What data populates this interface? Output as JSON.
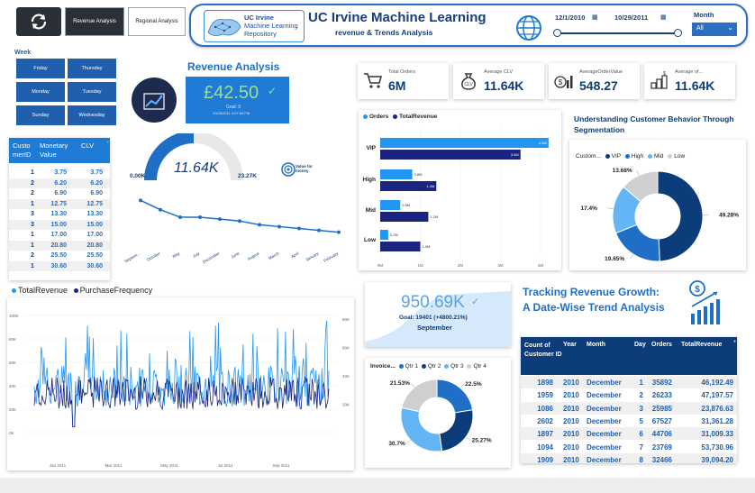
{
  "nav": {
    "revenue_tab": "Revenue Analysis",
    "regional_tab": "Regional Analysis"
  },
  "header": {
    "logo_line1": "UC Irvine",
    "logo_line2": "Machine Learning",
    "logo_line3": "Repository",
    "title": "UC Irvine Machine Learning",
    "subtitle": "revenue & Trends Analysis",
    "date_start": "12/1/2010",
    "date_end": "10/29/2011",
    "period_label": "Month",
    "period_value": "All"
  },
  "week": {
    "title": "Week",
    "days": [
      "Friday",
      "Thursday",
      "Monday",
      "Tuesday",
      "Sunday",
      "Wednesday"
    ]
  },
  "revenue_card": {
    "title": "Revenue Analysis",
    "value": "£42.50",
    "goal": "Goal: 0",
    "timestamp": "10/28/2011 4:07:00 PM"
  },
  "customer_table": {
    "headers": [
      "Custo merID",
      "Monetary Value",
      "CLV"
    ],
    "rows": [
      [
        "1",
        "3.75",
        "3.75"
      ],
      [
        "2",
        "6.20",
        "6.20"
      ],
      [
        "2",
        "6.90",
        "6.90"
      ],
      [
        "1",
        "12.75",
        "12.75"
      ],
      [
        "3",
        "13.30",
        "13.30"
      ],
      [
        "3",
        "15.00",
        "15.00"
      ],
      [
        "1",
        "17.00",
        "17.00"
      ],
      [
        "1",
        "20.80",
        "20.80"
      ],
      [
        "2",
        "25.50",
        "25.50"
      ],
      [
        "1",
        "30.60",
        "30.60"
      ]
    ]
  },
  "gauge": {
    "value": "11.64K",
    "min": "0.00K",
    "max": "23.27K",
    "fraction": 0.5
  },
  "value_for_money": "Value for money",
  "clv_trend": {
    "months": [
      "Septem...",
      "October",
      "May",
      "July",
      "December",
      "June",
      "August",
      "March",
      "April",
      "January",
      "February"
    ],
    "values": [
      12.6,
      12.1,
      11.7,
      11.7,
      11.6,
      11.5,
      11.3,
      11.2,
      11.1,
      11.0,
      10.9
    ]
  },
  "kpis": [
    {
      "label": "Total Orders",
      "value": "6M",
      "icon": "cart-icon"
    },
    {
      "label": "Average CLV",
      "value": "11.64K",
      "icon": "money-bag-icon"
    },
    {
      "label": "AverageOrderValue",
      "value": "548.27",
      "icon": "dollar-chart-icon"
    },
    {
      "label": "Average of...",
      "value": "11.64K",
      "icon": "coins-icon"
    }
  ],
  "segment_bar": {
    "legend": [
      "Orders",
      "TotalRevenue"
    ],
    "colors": [
      "#2196f3",
      "#1a237e"
    ],
    "x_ticks": [
      "0M",
      "1M",
      "2M",
      "3M",
      "4M"
    ]
  },
  "segmentation": {
    "title": "Understanding Customer Behavior Through Segmentation",
    "legend_title": "Custom...",
    "legend": [
      "VIP",
      "High",
      "Mid",
      "Low"
    ]
  },
  "timeseries": {
    "legend": [
      "TotalRevenue",
      "PurchaseFrequency"
    ],
    "left_ticks": [
      "100K",
      "80K",
      "60K",
      "40K",
      "20K",
      "0K"
    ],
    "right_ticks": [
      "80K",
      "60K",
      "40K",
      "20K"
    ],
    "x_ticks": [
      "Jan 2011",
      "Mar 2011",
      "May 2011",
      "Jul 2011",
      "Sep 2011"
    ]
  },
  "peak": {
    "value": "950.69K",
    "goal_text": "Goal: 19401 (+4800.21%)",
    "month": "September"
  },
  "quarter": {
    "legend_title": "Invoice...",
    "legend": [
      "Qtr 1",
      "Qtr 2",
      "Qtr 3",
      "Qtr 4"
    ]
  },
  "growth": {
    "title_line1": "Tracking Revenue Growth:",
    "title_line2": "A Date-Wise Trend Analysis"
  },
  "date_table": {
    "headers": [
      "Count of Customer ID",
      "Year",
      "Month",
      "Day",
      "Orders",
      "TotalRevenue"
    ],
    "rows": [
      [
        "1898",
        "2010",
        "December",
        "1",
        "35892",
        "46,192.49"
      ],
      [
        "1959",
        "2010",
        "December",
        "2",
        "26233",
        "47,197.57"
      ],
      [
        "1086",
        "2010",
        "December",
        "3",
        "25985",
        "23,876.63"
      ],
      [
        "2602",
        "2010",
        "December",
        "5",
        "67527",
        "31,361.28"
      ],
      [
        "1897",
        "2010",
        "December",
        "6",
        "44706",
        "31,009.33"
      ],
      [
        "1094",
        "2010",
        "December",
        "7",
        "23769",
        "53,730.96"
      ],
      [
        "1909",
        "2010",
        "December",
        "8",
        "32466",
        "39,094.20"
      ]
    ]
  },
  "chart_data": [
    {
      "type": "bar",
      "orientation": "horizontal",
      "categories": [
        "VIP",
        "High",
        "Mid",
        "Low"
      ],
      "series": [
        {
          "name": "Orders",
          "values": [
            4.2,
            0.8,
            0.5,
            0.2
          ],
          "labels": [
            "4.2M",
            "0.8M",
            "0.5M",
            "0.2M"
          ]
        },
        {
          "name": "TotalRevenue",
          "values": [
            3.5,
            1.4,
            1.2,
            1.0
          ],
          "labels": [
            "3.5M",
            "1.4M",
            "1.2M",
            "1.0M"
          ]
        }
      ],
      "xlim": [
        0,
        4
      ]
    },
    {
      "type": "pie",
      "title": "Understanding Customer Behavior Through Segmentation",
      "labels": [
        "VIP",
        "High",
        "Mid",
        "Low"
      ],
      "values": [
        49.28,
        19.65,
        17.4,
        13.68
      ],
      "value_labels": [
        "49.28%",
        "19.65%",
        "17.4%",
        "13.68%"
      ],
      "colors": [
        "#0d3c7a",
        "#1f6fc7",
        "#64b5f6",
        "#cfcfcf"
      ]
    },
    {
      "type": "pie",
      "labels": [
        "Qtr 1",
        "Qtr 2",
        "Qtr 3",
        "Qtr 4"
      ],
      "values": [
        22.5,
        25.27,
        30.7,
        21.53
      ],
      "value_labels": [
        "22.5%",
        "25.27%",
        "30.7%",
        "21.53%"
      ],
      "colors": [
        "#1f6fc7",
        "#0d3c7a",
        "#64b5f6",
        "#cfcfcf"
      ]
    },
    {
      "type": "line",
      "categories": [
        "Septem...",
        "October",
        "May",
        "July",
        "December",
        "June",
        "August",
        "March",
        "April",
        "January",
        "February"
      ],
      "values": [
        12.6,
        12.1,
        11.7,
        11.7,
        11.6,
        11.5,
        11.3,
        11.2,
        11.1,
        11.0,
        10.9
      ]
    },
    {
      "type": "line",
      "series": [
        {
          "name": "TotalRevenue",
          "note_values": "daily 20K-60K with spikes to ~90K"
        },
        {
          "name": "PurchaseFrequency",
          "note_values": "daily 20K-50K"
        }
      ],
      "x_range": [
        "Dec 2010",
        "Oct 2011"
      ],
      "ylim_left": [
        0,
        100000
      ],
      "ylim_right": [
        0,
        80000
      ]
    }
  ]
}
